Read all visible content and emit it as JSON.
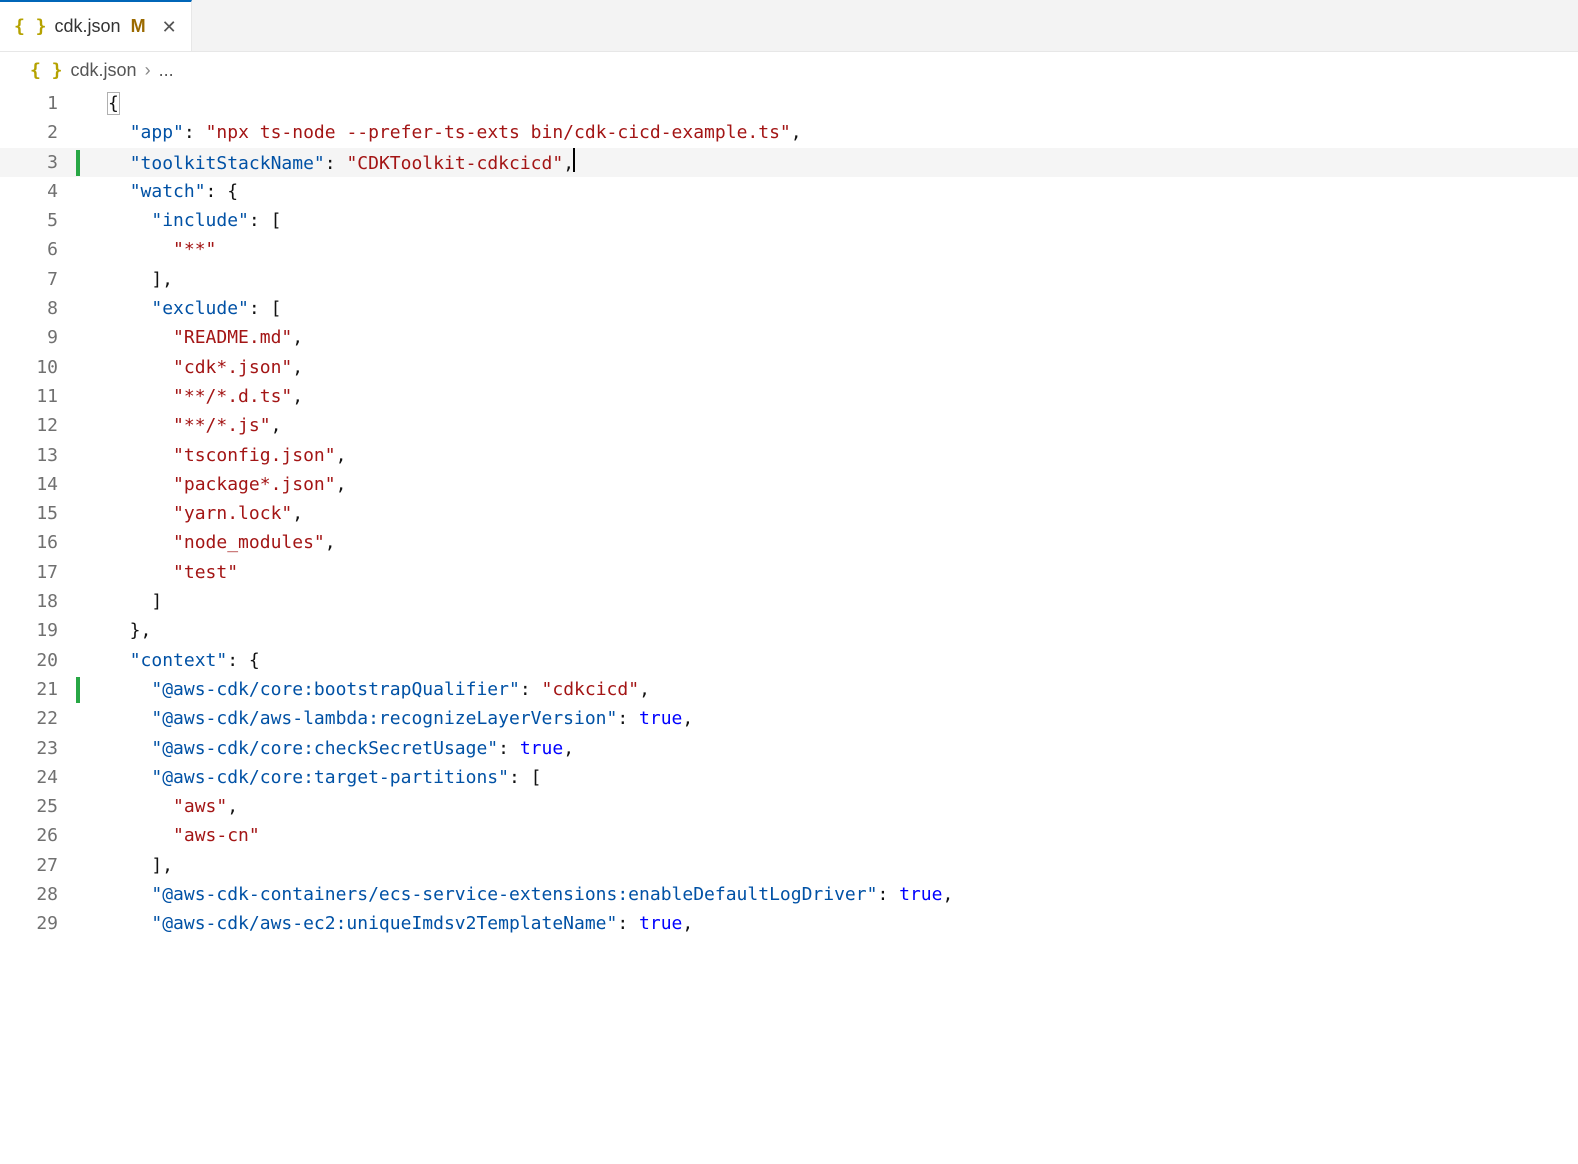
{
  "tab": {
    "filename": "cdk.json",
    "modified_badge": "M",
    "icon_glyph": "{ }"
  },
  "breadcrumb": {
    "icon_glyph": "{ }",
    "filename": "cdk.json",
    "rest": "..."
  },
  "gutter": {
    "start": 1,
    "end": 29
  },
  "modified_lines": [
    3,
    21
  ],
  "highlighted_line": 3,
  "code_lines": [
    [
      {
        "c": "p",
        "t": "{",
        "brace": true
      }
    ],
    [
      {
        "c": "p",
        "t": "  "
      },
      {
        "c": "k",
        "t": "\"app\""
      },
      {
        "c": "p",
        "t": ": "
      },
      {
        "c": "s",
        "t": "\"npx ts-node --prefer-ts-exts bin/cdk-cicd-example.ts\""
      },
      {
        "c": "p",
        "t": ","
      }
    ],
    [
      {
        "c": "p",
        "t": "  "
      },
      {
        "c": "k",
        "t": "\"toolkitStackName\""
      },
      {
        "c": "p",
        "t": ": "
      },
      {
        "c": "s",
        "t": "\"CDKToolkit-cdkcicd\""
      },
      {
        "c": "p",
        "t": ","
      },
      {
        "cursor": true
      }
    ],
    [
      {
        "c": "p",
        "t": "  "
      },
      {
        "c": "k",
        "t": "\"watch\""
      },
      {
        "c": "p",
        "t": ": {"
      }
    ],
    [
      {
        "c": "p",
        "t": "    "
      },
      {
        "c": "k",
        "t": "\"include\""
      },
      {
        "c": "p",
        "t": ": ["
      }
    ],
    [
      {
        "c": "p",
        "t": "      "
      },
      {
        "c": "s",
        "t": "\"**\""
      }
    ],
    [
      {
        "c": "p",
        "t": "    ],"
      }
    ],
    [
      {
        "c": "p",
        "t": "    "
      },
      {
        "c": "k",
        "t": "\"exclude\""
      },
      {
        "c": "p",
        "t": ": ["
      }
    ],
    [
      {
        "c": "p",
        "t": "      "
      },
      {
        "c": "s",
        "t": "\"README.md\""
      },
      {
        "c": "p",
        "t": ","
      }
    ],
    [
      {
        "c": "p",
        "t": "      "
      },
      {
        "c": "s",
        "t": "\"cdk*.json\""
      },
      {
        "c": "p",
        "t": ","
      }
    ],
    [
      {
        "c": "p",
        "t": "      "
      },
      {
        "c": "s",
        "t": "\"**/*.d.ts\""
      },
      {
        "c": "p",
        "t": ","
      }
    ],
    [
      {
        "c": "p",
        "t": "      "
      },
      {
        "c": "s",
        "t": "\"**/*.js\""
      },
      {
        "c": "p",
        "t": ","
      }
    ],
    [
      {
        "c": "p",
        "t": "      "
      },
      {
        "c": "s",
        "t": "\"tsconfig.json\""
      },
      {
        "c": "p",
        "t": ","
      }
    ],
    [
      {
        "c": "p",
        "t": "      "
      },
      {
        "c": "s",
        "t": "\"package*.json\""
      },
      {
        "c": "p",
        "t": ","
      }
    ],
    [
      {
        "c": "p",
        "t": "      "
      },
      {
        "c": "s",
        "t": "\"yarn.lock\""
      },
      {
        "c": "p",
        "t": ","
      }
    ],
    [
      {
        "c": "p",
        "t": "      "
      },
      {
        "c": "s",
        "t": "\"node_modules\""
      },
      {
        "c": "p",
        "t": ","
      }
    ],
    [
      {
        "c": "p",
        "t": "      "
      },
      {
        "c": "s",
        "t": "\"test\""
      }
    ],
    [
      {
        "c": "p",
        "t": "    ]"
      }
    ],
    [
      {
        "c": "p",
        "t": "  },"
      }
    ],
    [
      {
        "c": "p",
        "t": "  "
      },
      {
        "c": "k",
        "t": "\"context\""
      },
      {
        "c": "p",
        "t": ": {"
      }
    ],
    [
      {
        "c": "p",
        "t": "    "
      },
      {
        "c": "k",
        "t": "\"@aws-cdk/core:bootstrapQualifier\""
      },
      {
        "c": "p",
        "t": ": "
      },
      {
        "c": "s",
        "t": "\"cdkcicd\""
      },
      {
        "c": "p",
        "t": ","
      }
    ],
    [
      {
        "c": "p",
        "t": "    "
      },
      {
        "c": "k",
        "t": "\"@aws-cdk/aws-lambda:recognizeLayerVersion\""
      },
      {
        "c": "p",
        "t": ": "
      },
      {
        "c": "b",
        "t": "true"
      },
      {
        "c": "p",
        "t": ","
      }
    ],
    [
      {
        "c": "p",
        "t": "    "
      },
      {
        "c": "k",
        "t": "\"@aws-cdk/core:checkSecretUsage\""
      },
      {
        "c": "p",
        "t": ": "
      },
      {
        "c": "b",
        "t": "true"
      },
      {
        "c": "p",
        "t": ","
      }
    ],
    [
      {
        "c": "p",
        "t": "    "
      },
      {
        "c": "k",
        "t": "\"@aws-cdk/core:target-partitions\""
      },
      {
        "c": "p",
        "t": ": ["
      }
    ],
    [
      {
        "c": "p",
        "t": "      "
      },
      {
        "c": "s",
        "t": "\"aws\""
      },
      {
        "c": "p",
        "t": ","
      }
    ],
    [
      {
        "c": "p",
        "t": "      "
      },
      {
        "c": "s",
        "t": "\"aws-cn\""
      }
    ],
    [
      {
        "c": "p",
        "t": "    ],"
      }
    ],
    [
      {
        "c": "p",
        "t": "    "
      },
      {
        "c": "k",
        "t": "\"@aws-cdk-containers/ecs-service-extensions:enableDefaultLogDriver\""
      },
      {
        "c": "p",
        "t": ": "
      },
      {
        "c": "b",
        "t": "true"
      },
      {
        "c": "p",
        "t": ","
      }
    ],
    [
      {
        "c": "p",
        "t": "    "
      },
      {
        "c": "k",
        "t": "\"@aws-cdk/aws-ec2:uniqueImdsv2TemplateName\""
      },
      {
        "c": "p",
        "t": ": "
      },
      {
        "c": "b",
        "t": "true"
      },
      {
        "c": "p",
        "t": ","
      }
    ]
  ]
}
